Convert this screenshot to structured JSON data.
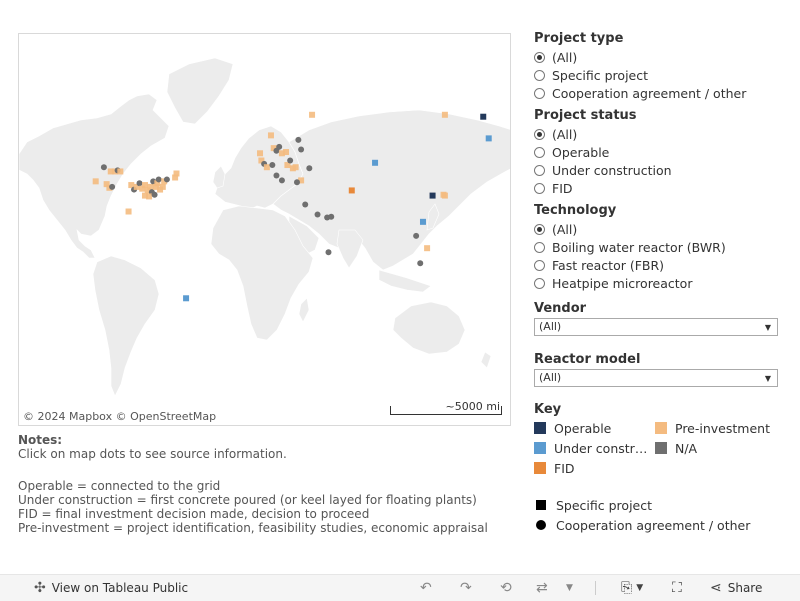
{
  "map": {
    "attribution": "© 2024 Mapbox  © OpenStreetMap",
    "scale_label": "~5000 mi",
    "colors": {
      "land": "#ececec",
      "water": "#ffffff",
      "border": "#ffffff"
    },
    "markers": [
      {
        "lon": -118,
        "lat": 51,
        "status": "N/A",
        "shape": "circle"
      },
      {
        "lon": -113,
        "lat": 49,
        "status": "Pre-investment",
        "shape": "square"
      },
      {
        "lon": -110,
        "lat": 49,
        "status": "Pre-investment",
        "shape": "square"
      },
      {
        "lon": -108,
        "lat": 49.5,
        "status": "N/A",
        "shape": "circle"
      },
      {
        "lon": -106,
        "lat": 49,
        "status": "Pre-investment",
        "shape": "square"
      },
      {
        "lon": -124,
        "lat": 44,
        "status": "Pre-investment",
        "shape": "square"
      },
      {
        "lon": -116,
        "lat": 42.5,
        "status": "Pre-investment",
        "shape": "square"
      },
      {
        "lon": -114,
        "lat": 40.5,
        "status": "Pre-investment",
        "shape": "square"
      },
      {
        "lon": -112,
        "lat": 41,
        "status": "N/A",
        "shape": "circle"
      },
      {
        "lon": -98,
        "lat": 42,
        "status": "Pre-investment",
        "shape": "square"
      },
      {
        "lon": -96,
        "lat": 39.5,
        "status": "N/A",
        "shape": "circle"
      },
      {
        "lon": -94,
        "lat": 41,
        "status": "Pre-investment",
        "shape": "square"
      },
      {
        "lon": -92,
        "lat": 43,
        "status": "N/A",
        "shape": "circle"
      },
      {
        "lon": -90,
        "lat": 40,
        "status": "Pre-investment",
        "shape": "square"
      },
      {
        "lon": -88,
        "lat": 42,
        "status": "Pre-investment",
        "shape": "square"
      },
      {
        "lon": -86,
        "lat": 39,
        "status": "Pre-investment",
        "shape": "square"
      },
      {
        "lon": -84,
        "lat": 41,
        "status": "Pre-investment",
        "shape": "square"
      },
      {
        "lon": -83,
        "lat": 38,
        "status": "N/A",
        "shape": "circle"
      },
      {
        "lon": -82,
        "lat": 44,
        "status": "N/A",
        "shape": "circle"
      },
      {
        "lon": -80,
        "lat": 41,
        "status": "Pre-investment",
        "shape": "square"
      },
      {
        "lon": -79,
        "lat": 43,
        "status": "Pre-investment",
        "shape": "square"
      },
      {
        "lon": -78,
        "lat": 45,
        "status": "N/A",
        "shape": "circle"
      },
      {
        "lon": -77,
        "lat": 39.5,
        "status": "Pre-investment",
        "shape": "square"
      },
      {
        "lon": -75,
        "lat": 41,
        "status": "Pre-investment",
        "shape": "square"
      },
      {
        "lon": -74,
        "lat": 44,
        "status": "Pre-investment",
        "shape": "square"
      },
      {
        "lon": -72,
        "lat": 45,
        "status": "N/A",
        "shape": "circle"
      },
      {
        "lon": -66,
        "lat": 46,
        "status": "Pre-investment",
        "shape": "square"
      },
      {
        "lon": -65,
        "lat": 48,
        "status": "Pre-investment",
        "shape": "square"
      },
      {
        "lon": -88,
        "lat": 36,
        "status": "Pre-investment",
        "shape": "square"
      },
      {
        "lon": -85,
        "lat": 35.5,
        "status": "Pre-investment",
        "shape": "square"
      },
      {
        "lon": -81,
        "lat": 36.5,
        "status": "N/A",
        "shape": "circle"
      },
      {
        "lon": -100,
        "lat": 26,
        "status": "Pre-investment",
        "shape": "square"
      },
      {
        "lon": -58,
        "lat": -34.5,
        "status": "Under construction",
        "shape": "square"
      },
      {
        "lon": -4,
        "lat": 57,
        "status": "Pre-investment",
        "shape": "square"
      },
      {
        "lon": -3,
        "lat": 54,
        "status": "Pre-investment",
        "shape": "square"
      },
      {
        "lon": -1,
        "lat": 52.5,
        "status": "N/A",
        "shape": "circle"
      },
      {
        "lon": 1,
        "lat": 51,
        "status": "Pre-investment",
        "shape": "square"
      },
      {
        "lon": 5,
        "lat": 52,
        "status": "N/A",
        "shape": "circle"
      },
      {
        "lon": 4,
        "lat": 63.5,
        "status": "Pre-investment",
        "shape": "square"
      },
      {
        "lon": 6,
        "lat": 59,
        "status": "Pre-investment",
        "shape": "square"
      },
      {
        "lon": 8,
        "lat": 58,
        "status": "N/A",
        "shape": "circle"
      },
      {
        "lon": 10,
        "lat": 59.5,
        "status": "N/A",
        "shape": "circle"
      },
      {
        "lon": 12,
        "lat": 57,
        "status": "Pre-investment",
        "shape": "square"
      },
      {
        "lon": 15,
        "lat": 57.5,
        "status": "Pre-investment",
        "shape": "square"
      },
      {
        "lon": 16,
        "lat": 52,
        "status": "Pre-investment",
        "shape": "square"
      },
      {
        "lon": 18,
        "lat": 54,
        "status": "N/A",
        "shape": "circle"
      },
      {
        "lon": 20,
        "lat": 50.5,
        "status": "Pre-investment",
        "shape": "square"
      },
      {
        "lon": 22,
        "lat": 51,
        "status": "Pre-investment",
        "shape": "square"
      },
      {
        "lon": 24,
        "lat": 62,
        "status": "N/A",
        "shape": "circle"
      },
      {
        "lon": 26,
        "lat": 58.5,
        "status": "N/A",
        "shape": "circle"
      },
      {
        "lon": 26,
        "lat": 44.5,
        "status": "Pre-investment",
        "shape": "square"
      },
      {
        "lon": 23,
        "lat": 43.5,
        "status": "N/A",
        "shape": "circle"
      },
      {
        "lon": 12,
        "lat": 44.5,
        "status": "N/A",
        "shape": "circle"
      },
      {
        "lon": 8,
        "lat": 47,
        "status": "N/A",
        "shape": "circle"
      },
      {
        "lon": 32,
        "lat": 50.5,
        "status": "N/A",
        "shape": "circle"
      },
      {
        "lon": 34,
        "lat": 69.5,
        "status": "Pre-investment",
        "shape": "square"
      },
      {
        "lon": 29,
        "lat": 30.5,
        "status": "N/A",
        "shape": "circle"
      },
      {
        "lon": 38,
        "lat": 24,
        "status": "N/A",
        "shape": "circle"
      },
      {
        "lon": 45,
        "lat": 22,
        "status": "N/A",
        "shape": "circle"
      },
      {
        "lon": 48,
        "lat": 22.5,
        "status": "N/A",
        "shape": "circle"
      },
      {
        "lon": 63,
        "lat": 39,
        "status": "FID",
        "shape": "square"
      },
      {
        "lon": 80,
        "lat": 53,
        "status": "Under construction",
        "shape": "square"
      },
      {
        "lon": 46,
        "lat": -3,
        "status": "N/A",
        "shape": "circle"
      },
      {
        "lon": 110,
        "lat": 9,
        "status": "N/A",
        "shape": "circle"
      },
      {
        "lon": 115,
        "lat": 19,
        "status": "Under construction",
        "shape": "square"
      },
      {
        "lon": 118,
        "lat": 0,
        "status": "Pre-investment",
        "shape": "square"
      },
      {
        "lon": 113,
        "lat": -11,
        "status": "N/A",
        "shape": "circle"
      },
      {
        "lon": 122,
        "lat": 36,
        "status": "Operable",
        "shape": "square"
      },
      {
        "lon": 130,
        "lat": 36.5,
        "status": "Pre-investment",
        "shape": "square"
      },
      {
        "lon": 131,
        "lat": 36,
        "status": "Pre-investment",
        "shape": "square"
      },
      {
        "lon": 131,
        "lat": 69.5,
        "status": "Pre-investment",
        "shape": "square"
      },
      {
        "lon": 159,
        "lat": 69,
        "status": "Operable",
        "shape": "square"
      },
      {
        "lon": 163,
        "lat": 62.5,
        "status": "Under construction",
        "shape": "square"
      }
    ]
  },
  "notes": {
    "title": "Notes:",
    "line1": "Click on map dots to see source information.",
    "line2": "Operable = connected to the grid",
    "line3": "Under construction = first concrete poured (or keel layed for floating plants)",
    "line4": "FID = final investment decision made, decision to proceed",
    "line5": "Pre-investment = project identification, feasibility studies, economic appraisal"
  },
  "filters": {
    "project_type": {
      "title": "Project type",
      "options": [
        "(All)",
        "Specific project",
        "Cooperation agreement / other"
      ],
      "selected": 0
    },
    "project_status": {
      "title": "Project status",
      "options": [
        "(All)",
        "Operable",
        "Under construction",
        "FID"
      ],
      "selected": 0
    },
    "technology": {
      "title": "Technology",
      "options": [
        "(All)",
        "Boiling water reactor (BWR)",
        "Fast reactor (FBR)",
        "Heatpipe microreactor"
      ],
      "selected": 0
    },
    "vendor": {
      "title": "Vendor",
      "value": "(All)"
    },
    "reactor_model": {
      "title": "Reactor model",
      "value": "(All)"
    }
  },
  "key": {
    "title": "Key",
    "status_items": [
      {
        "label": "Operable",
        "color": "#23395b"
      },
      {
        "label": "Pre-investment",
        "color": "#f4bb80"
      },
      {
        "label": "Under construction",
        "color": "#5b9bd0"
      },
      {
        "label": "N/A",
        "color": "#6f6f6f"
      },
      {
        "label": "FID",
        "color": "#e8893a"
      }
    ],
    "shape_items": [
      {
        "label": "Specific project",
        "shape": "square"
      },
      {
        "label": "Cooperation agreement / other",
        "shape": "circle"
      }
    ]
  },
  "footer": {
    "view_label": "View on Tableau Public",
    "share_label": "Share"
  }
}
